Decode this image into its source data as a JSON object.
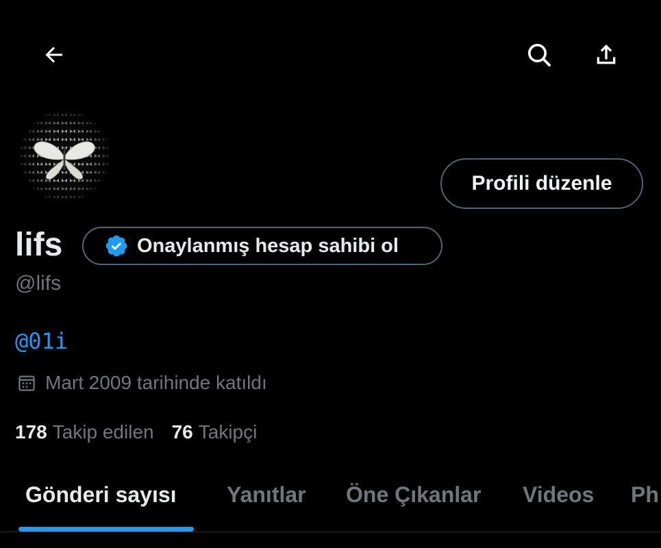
{
  "header": {
    "back_icon": "arrow-left-icon",
    "search_icon": "search-icon",
    "share_icon": "share-upload-icon"
  },
  "profile": {
    "avatar": "butterfly-avatar",
    "display_name": "lifs",
    "handle": "@lifs",
    "bio_link": "@01i",
    "joined": "Mart 2009 tarihinde katıldı",
    "edit_button_label": "Profili düzenle",
    "verify_label": "Onaylanmış hesap sahibi ol",
    "verify_icon": "verified-badge-icon",
    "calendar_icon": "calendar-icon",
    "following_count": "178",
    "following_label": "Takip edilen",
    "followers_count": "76",
    "followers_label": "Takipçi"
  },
  "tabs": [
    {
      "label": "Gönderi sayısı",
      "active": true
    },
    {
      "label": "Yanıtlar",
      "active": false
    },
    {
      "label": "Öne Çıkanlar",
      "active": false
    },
    {
      "label": "Videos",
      "active": false
    },
    {
      "label": "Ph",
      "active": false
    }
  ],
  "colors": {
    "background": "#000000",
    "accent": "#1d9bf0",
    "primary_text": "#e7e9ea",
    "secondary_text": "#71767b",
    "border": "#536471"
  }
}
